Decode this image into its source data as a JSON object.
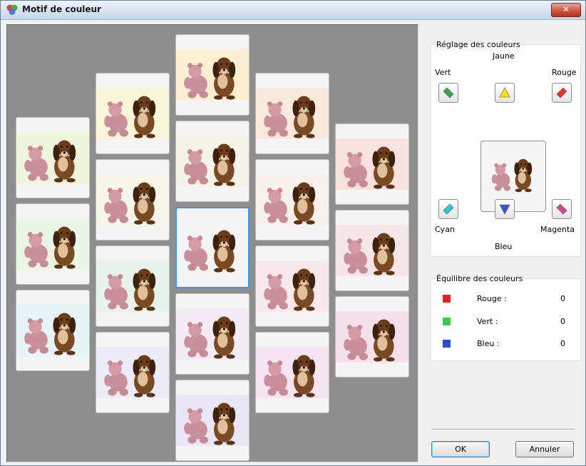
{
  "window": {
    "title": "Motif de couleur",
    "close_glyph": "✕"
  },
  "icons": {
    "app": "palette-app-icon",
    "close": "close-icon"
  },
  "color_adjust": {
    "legend": "Réglage des couleurs",
    "labels": {
      "yellow": "Jaune",
      "green": "Vert",
      "red": "Rouge",
      "cyan": "Cyan",
      "magenta": "Magenta",
      "blue": "Bleu"
    },
    "button_colors": {
      "green": "#2fa84f",
      "yellow": "#f4e200",
      "red": "#e8332a",
      "cyan": "#2ec8d8",
      "blue": "#3a55d6",
      "magenta": "#d2468f"
    }
  },
  "color_balance": {
    "legend": "Équilibre des couleurs",
    "rows": [
      {
        "label": "Rouge :",
        "value": "0",
        "swatch": "#ee1c1c"
      },
      {
        "label": "Vert :",
        "value": "0",
        "swatch": "#3cc84a"
      },
      {
        "label": "Bleu :",
        "value": "0",
        "swatch": "#2b4fc8"
      }
    ]
  },
  "buttons": {
    "ok": "OK",
    "cancel": "Annuler"
  },
  "patterns": {
    "tints": [
      "#e6f0c8",
      "#ddf0d8",
      "#d8eef2",
      "#f4f0c4",
      "#f0f0dc",
      "#dcebe4",
      "#e4e0f4",
      "#fae6b8",
      "#f0ecdc",
      "#eeeeee",
      "#ece0f2",
      "#dcd8ee",
      "#f8dcc8",
      "#f4e8e2",
      "#f2dce4",
      "#f0d4e8",
      "#f6d2cc",
      "#f2d8dc",
      "#f0d0de"
    ],
    "selected_index": 9
  }
}
